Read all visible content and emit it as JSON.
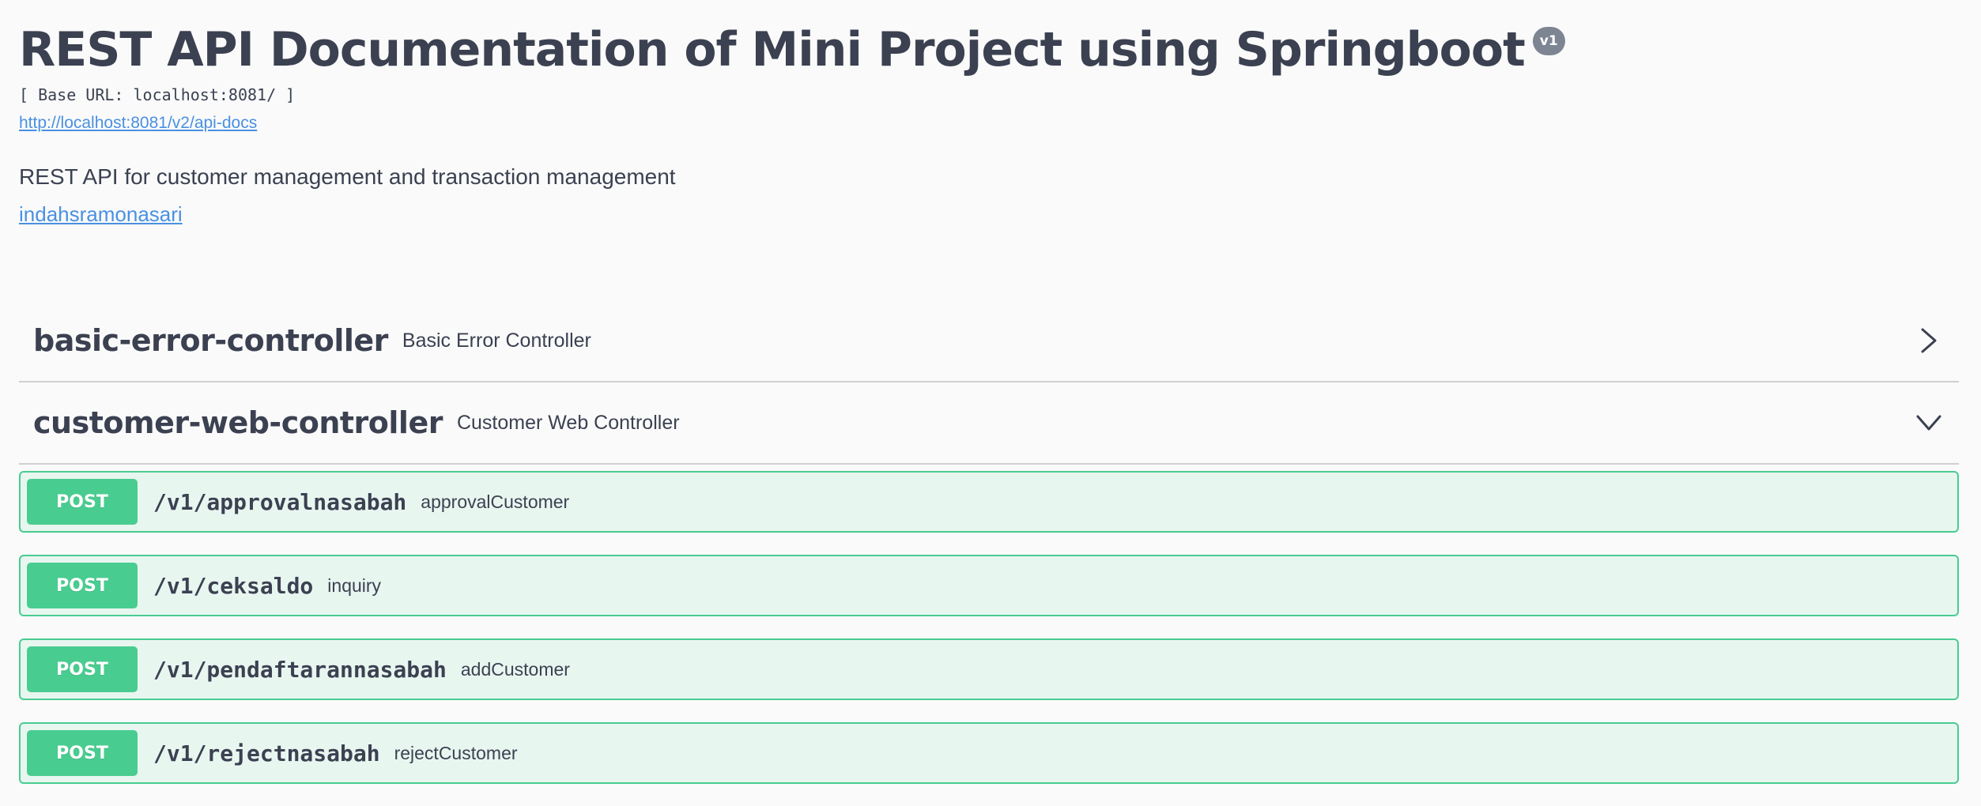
{
  "info": {
    "title": "REST API Documentation of Mini Project using Springboot",
    "version": "v1",
    "base_url": "[ Base URL: localhost:8081/ ]",
    "spec_link": "http://localhost:8081/v2/api-docs",
    "description": "REST API for customer management and transaction management",
    "contact": "indahsramonasari"
  },
  "tags": [
    {
      "name": "basic-error-controller",
      "description": "Basic Error Controller",
      "expanded": false,
      "chevron_icon": "chevron-right-icon"
    },
    {
      "name": "customer-web-controller",
      "description": "Customer Web Controller",
      "expanded": true,
      "chevron_icon": "chevron-down-icon",
      "operations": [
        {
          "method": "POST",
          "path": "/v1/approvalnasabah",
          "summary": "approvalCustomer"
        },
        {
          "method": "POST",
          "path": "/v1/ceksaldo",
          "summary": "inquiry"
        },
        {
          "method": "POST",
          "path": "/v1/pendaftarannasabah",
          "summary": "addCustomer"
        },
        {
          "method": "POST",
          "path": "/v1/rejectnasabah",
          "summary": "rejectCustomer"
        }
      ]
    }
  ],
  "colors": {
    "post_accent": "#49cc90",
    "post_background": "#e8f6f0",
    "link": "#4990e2",
    "text": "#3b4151",
    "badge": "#7d8492"
  }
}
